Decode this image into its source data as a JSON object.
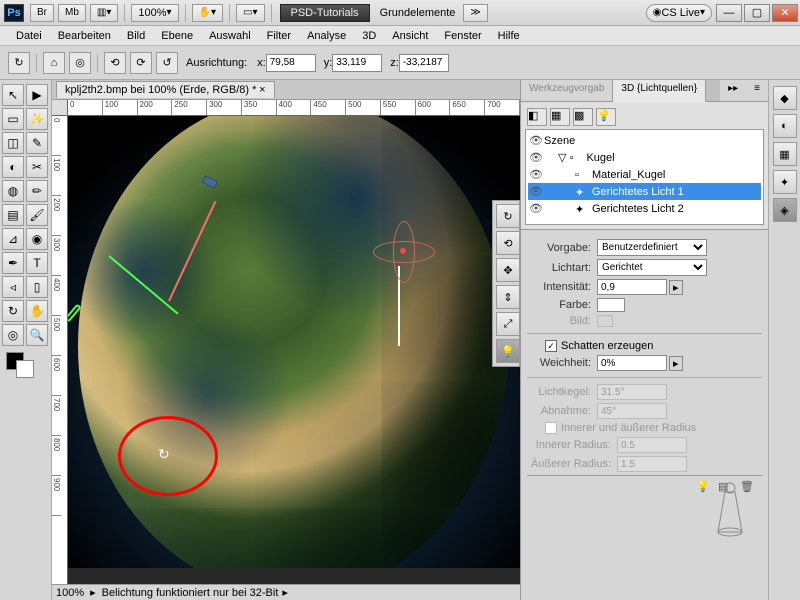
{
  "titlebar": {
    "ps": "Ps",
    "br": "Br",
    "mb": "Mb",
    "zoom": "100%",
    "dark_label": "PSD-Tutorials",
    "secondary": "Grundelemente",
    "cslive": "CS Live"
  },
  "menu": [
    "Datei",
    "Bearbeiten",
    "Bild",
    "Ebene",
    "Auswahl",
    "Filter",
    "Analyse",
    "3D",
    "Ansicht",
    "Fenster",
    "Hilfe"
  ],
  "optbar": {
    "orient_label": "Ausrichtung:",
    "x_label": "x:",
    "x": "79,58",
    "y_label": "y:",
    "y": "33,119",
    "z_label": "z:",
    "z": "-33,2187"
  },
  "doc_tab": "kplj2th2.bmp bei 100% (Erde, RGB/8) *",
  "ruler_h": [
    "0",
    "100",
    "200",
    "250",
    "300",
    "350",
    "400",
    "450",
    "500",
    "550",
    "600",
    "650",
    "700"
  ],
  "ruler_v": [
    "0",
    "100",
    "200",
    "300",
    "400",
    "500",
    "600",
    "700",
    "800",
    "900"
  ],
  "status": {
    "zoom": "100%",
    "msg": "Belichtung funktioniert nur bei 32-Bit"
  },
  "panel": {
    "tab1": "Werkzeugvorgab",
    "tab2": "3D {Lichtquellen}",
    "tree": {
      "scene": "Szene",
      "items": [
        {
          "label": "Kugel",
          "indent": 1,
          "icon": "mesh"
        },
        {
          "label": "Material_Kugel",
          "indent": 2,
          "icon": "mat"
        },
        {
          "label": "Gerichtetes Licht 1",
          "indent": 2,
          "icon": "light",
          "selected": true
        },
        {
          "label": "Gerichtetes Licht 2",
          "indent": 2,
          "icon": "light"
        }
      ]
    },
    "props": {
      "vorgabe_label": "Vorgabe:",
      "vorgabe": "Benutzerdefiniert",
      "lichtart_label": "Lichtart:",
      "lichtart": "Gerichtet",
      "intensitaet_label": "Intensität:",
      "intensitaet": "0,9",
      "farbe_label": "Farbe:",
      "bild_label": "Bild:",
      "schatten_label": "Schatten erzeugen",
      "schatten_checked": true,
      "weichheit_label": "Weichheit:",
      "weichheit": "0%",
      "lichtkegel_label": "Lichtkegel:",
      "lichtkegel": "31.5°",
      "abnahme_label": "Abnahme:",
      "abnahme": "45°",
      "innerouter_label": "Innerer und äußerer Radius",
      "innerer_label": "Innerer Radius:",
      "innerer": "0.5",
      "ausserer_label": "Äußerer Radius:",
      "ausserer": "1.5"
    }
  }
}
